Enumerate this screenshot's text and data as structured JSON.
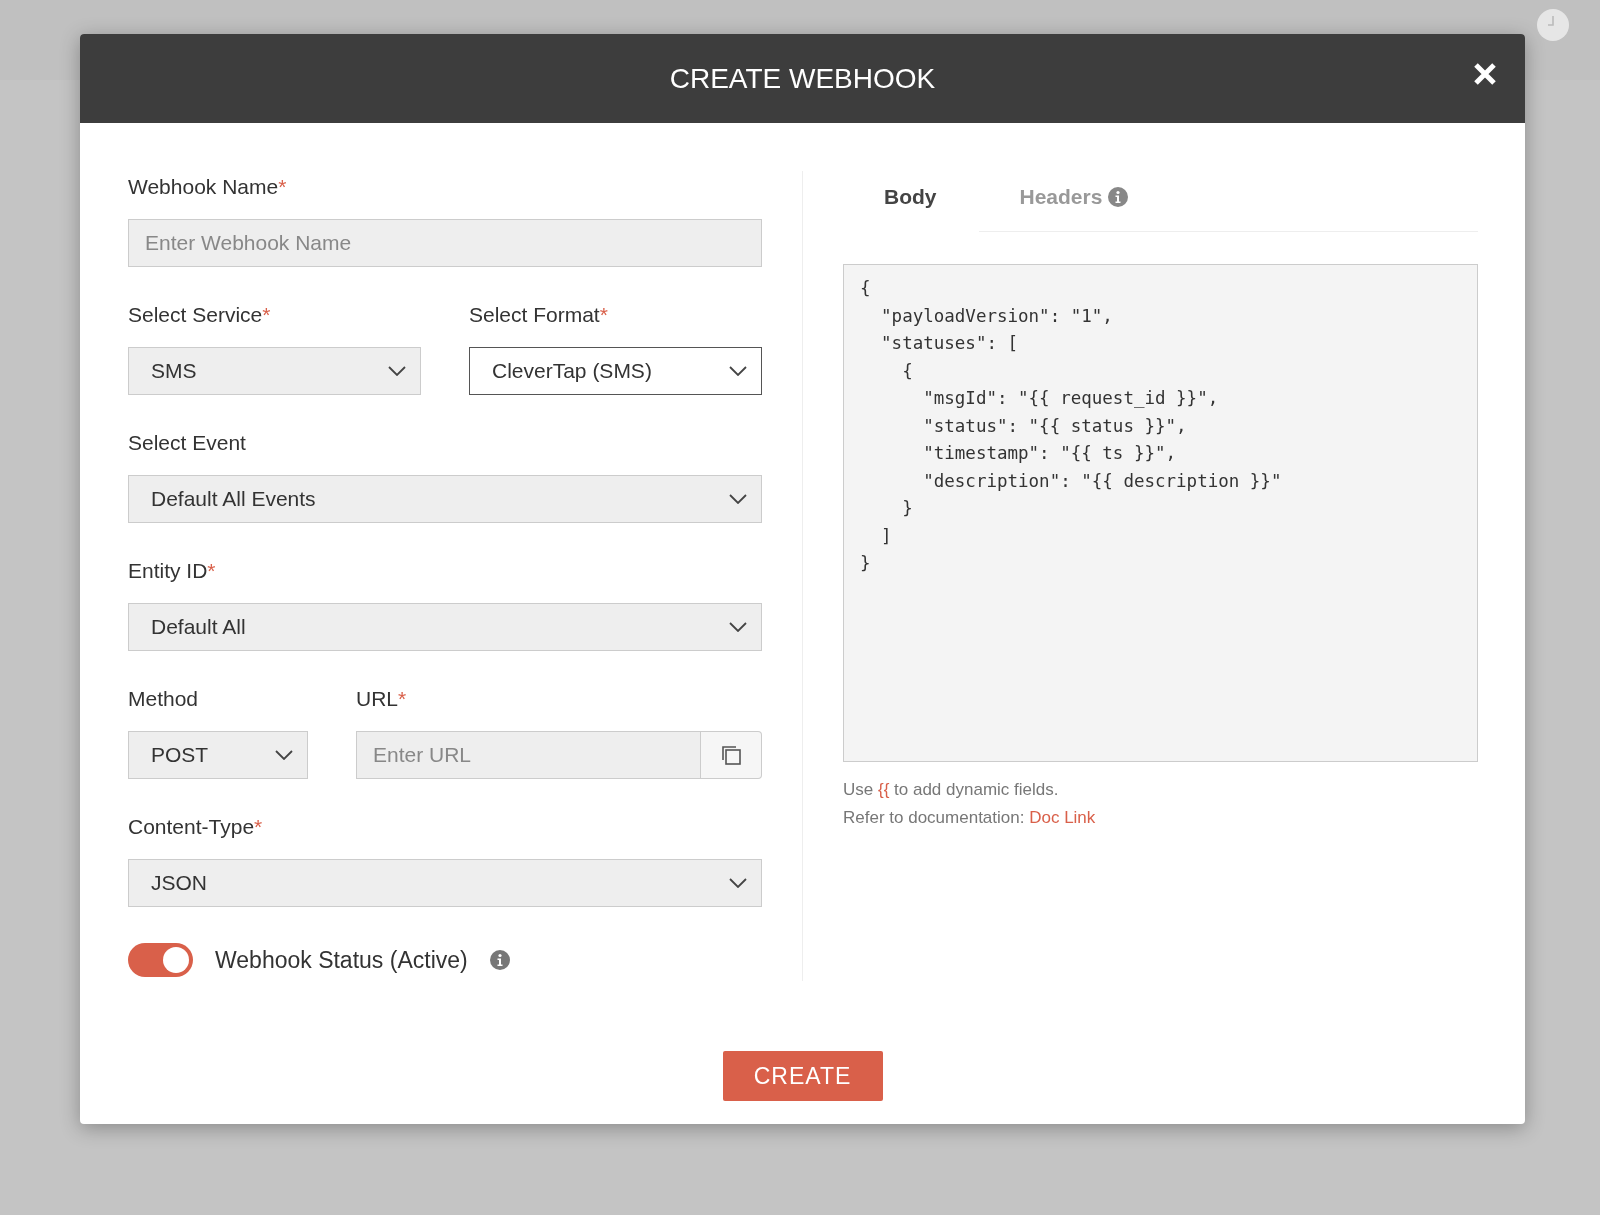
{
  "dialog": {
    "title": "CREATE WEBHOOK"
  },
  "required_mark": "*",
  "form": {
    "rows": [
      [
        {
          "kind": "text",
          "label": "Webhook Name",
          "required": true,
          "placeholder": "Enter Webhook Name",
          "focused": false
        }
      ],
      [
        {
          "kind": "select",
          "label": "Select Service",
          "required": true,
          "value": "SMS",
          "focused": false
        },
        {
          "kind": "select",
          "label": "Select Format",
          "required": true,
          "value": "CleverTap (SMS)",
          "focused": true
        }
      ],
      [
        {
          "kind": "select",
          "label": "Select Event",
          "required": false,
          "value": "Default All Events",
          "focused": false
        }
      ],
      [
        {
          "kind": "select",
          "label": "Entity ID",
          "required": true,
          "value": "Default All",
          "focused": false
        }
      ],
      [
        {
          "kind": "select",
          "label": "Method",
          "required": false,
          "value": "POST",
          "focused": false
        },
        {
          "kind": "url",
          "label": "URL",
          "required": true,
          "placeholder": "Enter URL",
          "focused": false
        }
      ],
      [
        {
          "kind": "select",
          "label": "Content-Type",
          "required": true,
          "value": "JSON",
          "focused": false
        }
      ]
    ],
    "status_toggle": {
      "label": "Webhook Status (Active)",
      "on": true
    }
  },
  "tabs": [
    {
      "label": "Body",
      "selected": true,
      "info": false
    },
    {
      "label": "Headers",
      "selected": false,
      "info": true
    }
  ],
  "body_code": [
    "{",
    "  \"payloadVersion\": \"1\",",
    "  \"statuses\": [",
    "    {",
    "      \"msgId\": \"{{ request_id }}\",",
    "      \"status\": \"{{ status }}\",",
    "      \"timestamp\": \"{{ ts }}\",",
    "      \"description\": \"{{ description }}\"",
    "    }",
    "  ]",
    "}"
  ],
  "hint": {
    "before": "Use",
    "token": "{{",
    "after": "to add dynamic fields."
  },
  "doc": {
    "text": "Refer to documentation:",
    "link": "Doc Link"
  },
  "create_button": "CREATE"
}
